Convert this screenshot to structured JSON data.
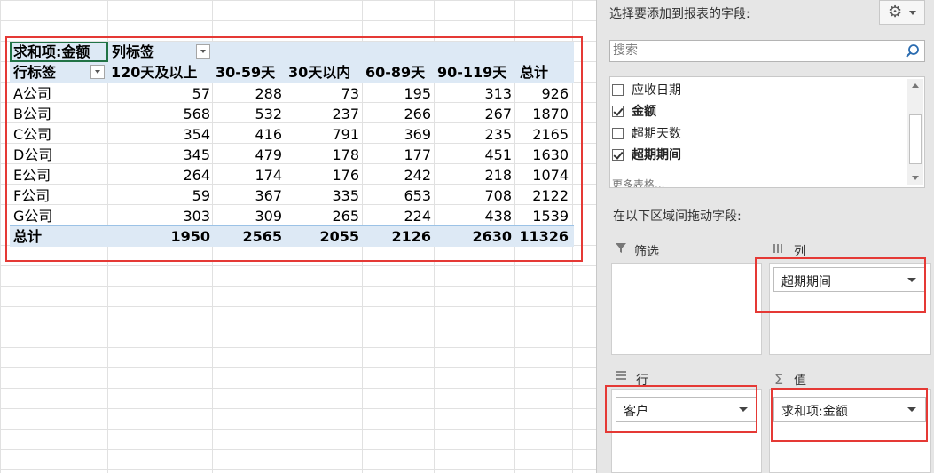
{
  "pivot": {
    "value_field_header": "求和项:金额",
    "column_labels_header": "列标签",
    "row_labels_header": "行标签",
    "columns": [
      "120天及以上",
      "30-59天",
      "30天以内",
      "60-89天",
      "90-119天",
      "总计"
    ],
    "rows": [
      {
        "label": "A公司",
        "values": [
          "57",
          "288",
          "73",
          "195",
          "313",
          "926"
        ]
      },
      {
        "label": "B公司",
        "values": [
          "568",
          "532",
          "237",
          "266",
          "267",
          "1870"
        ]
      },
      {
        "label": "C公司",
        "values": [
          "354",
          "416",
          "791",
          "369",
          "235",
          "2165"
        ]
      },
      {
        "label": "D公司",
        "values": [
          "345",
          "479",
          "178",
          "177",
          "451",
          "1630"
        ]
      },
      {
        "label": "E公司",
        "values": [
          "264",
          "174",
          "176",
          "242",
          "218",
          "1074"
        ]
      },
      {
        "label": "F公司",
        "values": [
          "59",
          "367",
          "335",
          "653",
          "708",
          "2122"
        ]
      },
      {
        "label": "G公司",
        "values": [
          "303",
          "309",
          "265",
          "224",
          "438",
          "1539"
        ]
      }
    ],
    "total": {
      "label": "总计",
      "values": [
        "1950",
        "2565",
        "2055",
        "2126",
        "2630",
        "11326"
      ]
    }
  },
  "field_pane": {
    "title": "选择要添加到报表的字段:",
    "search_placeholder": "搜索",
    "fields": [
      {
        "label": "应收日期",
        "checked": false
      },
      {
        "label": "金额",
        "checked": true
      },
      {
        "label": "超期天数",
        "checked": false
      },
      {
        "label": "超期期间",
        "checked": true
      }
    ],
    "more_tables": "更多表格...",
    "drag_hint": "在以下区域间拖动字段:",
    "areas": {
      "filter": {
        "label": "筛选",
        "chip": ""
      },
      "columns": {
        "label": "列",
        "chip": "超期期间"
      },
      "rows": {
        "label": "行",
        "chip": "客户"
      },
      "values": {
        "label": "值",
        "chip": "求和项:金额"
      }
    }
  },
  "colors": {
    "highlight_border": "#e53935",
    "pivot_header_fill": "#dde9f5",
    "selected_cell_border": "#217346"
  }
}
